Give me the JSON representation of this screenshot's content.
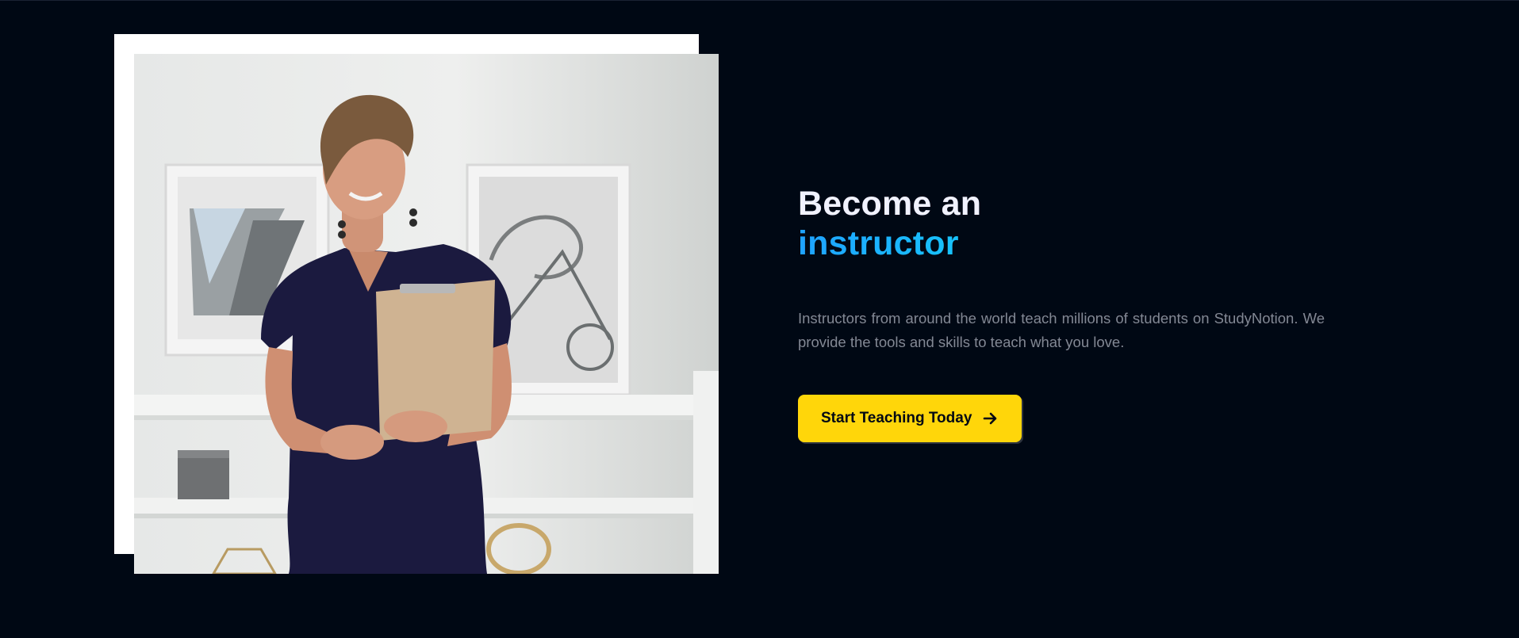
{
  "instructor_section": {
    "image": {
      "alt": "Smiling instructor holding a clipboard"
    },
    "heading": {
      "line1": "Become an",
      "accent": "instructor"
    },
    "description": "Instructors from around the world teach millions of students on StudyNotion. We provide the tools and skills to teach what you love.",
    "cta": {
      "label": "Start Teaching Today",
      "icon": "arrow-right-icon"
    }
  },
  "colors": {
    "background": "#000814",
    "heading": "#f1f2ff",
    "accent_gradient_start": "#1fa2ff",
    "accent_gradient_end": "#12d8fa",
    "description": "#838894",
    "button_bg": "#ffd60a",
    "button_text": "#000814",
    "frame": "#ffffff"
  }
}
